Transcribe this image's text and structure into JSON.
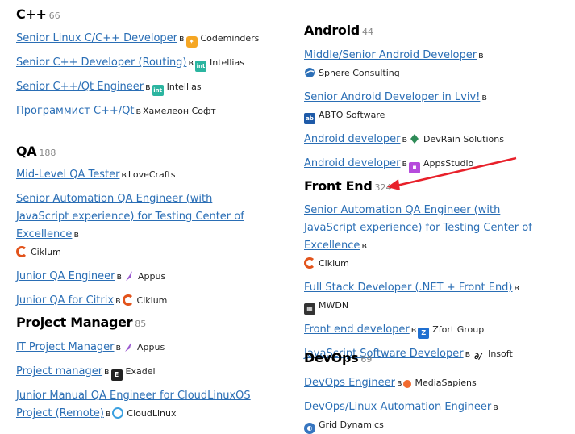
{
  "connector": "в",
  "annotation": {
    "color": "#e8202a"
  },
  "left": [
    {
      "title": "C++",
      "count": "66",
      "jobs": [
        {
          "title": "Senior Linux C/C++ Developer",
          "company": "Codeminders",
          "logo": "codeminders-logo-icon"
        },
        {
          "title": "Senior C++ Developer (Routing)",
          "company": "Intellias",
          "logo": "intellias-logo-icon"
        },
        {
          "title": "Senior C++/Qt Engineer",
          "company": "Intellias",
          "logo": "intellias-logo-icon"
        },
        {
          "title": "Программист C++/Qt",
          "company": "Хамелеон Софт",
          "logo": ""
        }
      ]
    },
    {
      "title": "QA",
      "count": "188",
      "jobs": [
        {
          "title": "Mid-Level QA Tester",
          "company": "LoveCrafts",
          "logo": ""
        },
        {
          "title": "Senior Automation QA Engineer (with JavaScript experience) for Testing Center of Excellence",
          "company": "Ciklum",
          "logo": "ciklum-logo-icon"
        },
        {
          "title": "Junior QA Engineer",
          "company": "Appus",
          "logo": "appus-logo-icon"
        },
        {
          "title": "Junior QA for Citrix",
          "company": "Ciklum",
          "logo": "ciklum-logo-icon"
        }
      ]
    },
    {
      "title": "Project Manager",
      "count": "85",
      "jobs": [
        {
          "title": "IT Project Manager",
          "company": "Appus",
          "logo": "appus-logo-icon"
        },
        {
          "title": "Project manager",
          "company": "Exadel",
          "logo": "exadel-logo-icon"
        },
        {
          "title": "Junior Manual QA Engineer for CloudLinuxOS Project (Remote)",
          "company": "CloudLinux",
          "logo": "cloudlinux-logo-icon"
        }
      ]
    }
  ],
  "right": [
    {
      "title": "Android",
      "count": "44",
      "jobs": [
        {
          "title": "Middle/Senior Android Developer",
          "company": "Sphere Consulting",
          "logo": "sphere-logo-icon"
        },
        {
          "title": "Senior Android Developer in Lviv!",
          "company": "ABTO Software",
          "logo": "abto-logo-icon"
        },
        {
          "title": "Android developer",
          "company": "DevRain Solutions",
          "logo": "devrain-logo-icon"
        },
        {
          "title": "Android developer",
          "company": "AppsStudio",
          "logo": "appsstudio-logo-icon"
        }
      ]
    },
    {
      "title": "Front End",
      "count": "324",
      "jobs": [
        {
          "title": "Senior Automation QA Engineer (with JavaScript experience) for Testing Center of Excellence",
          "company": "Ciklum",
          "logo": "ciklum-logo-icon"
        },
        {
          "title": "Full Stack Developer (.NET + Front End)",
          "company": "MWDN",
          "logo": "mwdn-logo-icon"
        },
        {
          "title": "Front end developer",
          "company": "Zfort Group",
          "logo": "zfort-logo-icon"
        },
        {
          "title": "JavaScript Software Developer",
          "company": "Insoft",
          "logo": "insoft-logo-icon"
        }
      ]
    },
    {
      "title": "DevOps",
      "count": "69",
      "jobs": [
        {
          "title": "DevOps Engineer",
          "company": "MediaSapiens",
          "logo": "mediasapiens-logo-icon"
        },
        {
          "title": "DevOps/Linux Automation Engineer",
          "company": "Grid Dynamics",
          "logo": "griddynamics-logo-icon"
        }
      ]
    }
  ]
}
